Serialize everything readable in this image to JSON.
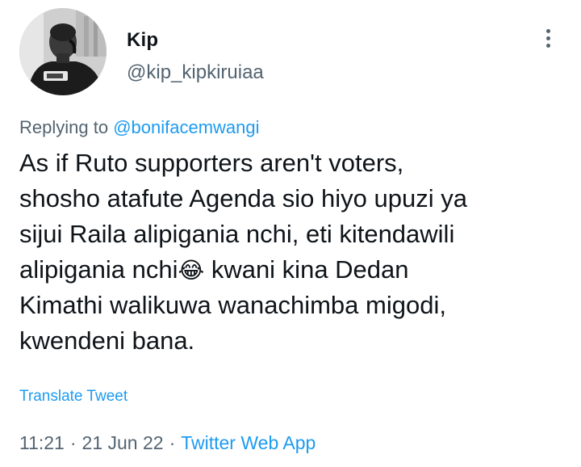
{
  "author": {
    "display_name": "Kip",
    "handle": "@kip_kipkiruiaa",
    "avatar": "profile-photo-grayscale"
  },
  "more_icon": "more-vertical-icon",
  "reply_context": {
    "prefix": "Replying to",
    "mention": "@bonifacemwangi"
  },
  "tweet": {
    "lines": [
      "As if Ruto supporters aren't voters,",
      "shosho atafute Agenda sio hiyo upuzi ya",
      "sijui Raila alipigania nchi, eti kitendawili",
      "alipigania nchi",
      " kwani kina Dedan",
      "Kimathi walikuwa wanachimba migodi,",
      "kwendeni bana."
    ],
    "emoji": "😂"
  },
  "translate_label": "Translate Tweet",
  "timestamp": {
    "time": "11:21",
    "separator": "·",
    "date": "21 Jun 22",
    "source": "Twitter Web App"
  },
  "colors": {
    "link": "#1d9bf0",
    "secondary_text": "#536471",
    "primary_text": "#0f1419"
  }
}
